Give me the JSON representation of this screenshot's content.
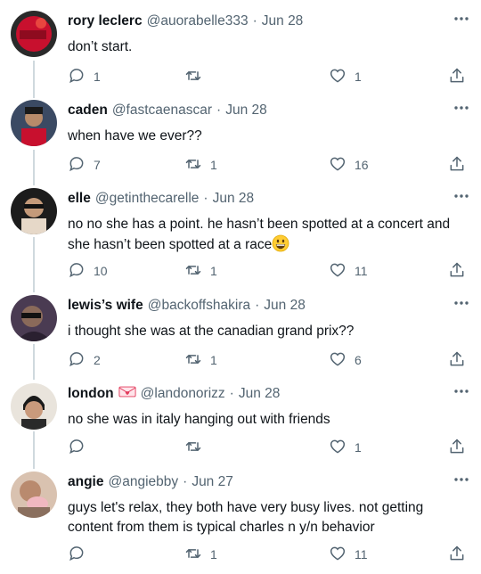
{
  "tweets": [
    {
      "name": "rory leclerc",
      "handle": "@auorabelle333",
      "date": "Jun 28",
      "text": "don’t start.",
      "replies": "1",
      "retweets": "",
      "likes": "1"
    },
    {
      "name": "caden",
      "handle": "@fastcaenascar",
      "date": "Jun 28",
      "text": "when have we ever??",
      "replies": "7",
      "retweets": "1",
      "likes": "16"
    },
    {
      "name": "elle",
      "handle": "@getinthecarelle",
      "date": "Jun 28",
      "text_line1": "no no she has a point. he hasn’t been spotted at a concert and",
      "text_line2": "she hasn’t been spotted at a race",
      "replies": "10",
      "retweets": "1",
      "likes": "11"
    },
    {
      "name": "lewis’s wife",
      "handle": "@backoffshakira",
      "date": "Jun 28",
      "text": "i thought she was at the canadian grand prix??",
      "replies": "2",
      "retweets": "1",
      "likes": "6"
    },
    {
      "name": "london",
      "handle": "@landonorizz",
      "date": "Jun 28",
      "text": "no she was in italy hanging out with friends",
      "replies": "",
      "retweets": "",
      "likes": "1"
    },
    {
      "name": "angie",
      "handle": "@angiebby",
      "date": "Jun 27",
      "text_line1": "guys let's relax, they both have very busy lives. not getting",
      "text_line2": "content from them is typical charles n y/n behavior",
      "replies": "",
      "retweets": "1",
      "likes": "11"
    }
  ],
  "icons": {
    "reply": "reply-icon",
    "retweet": "retweet-icon",
    "like": "heart-icon",
    "share": "share-icon",
    "more": "more-icon"
  },
  "colors": {
    "text": "#0f1419",
    "secondary": "#536471",
    "thread": "#cfd9de"
  }
}
